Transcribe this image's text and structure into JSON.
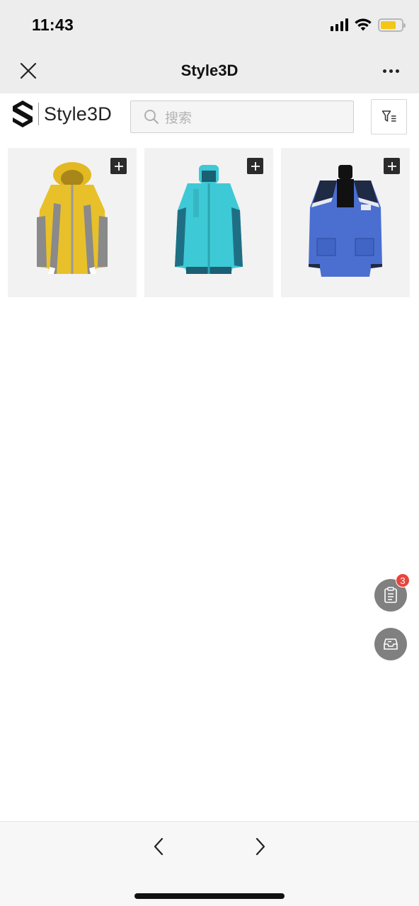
{
  "status_bar": {
    "time": "11:43",
    "icons": [
      "signal-icon",
      "wifi-icon",
      "battery-icon"
    ],
    "battery_color": "#f5c518"
  },
  "nav_bar": {
    "title": "Style3D",
    "left_icon": "close-icon",
    "right_icon": "more-icon"
  },
  "header": {
    "brand_name": "Style3D",
    "search": {
      "placeholder": "搜索",
      "value": ""
    },
    "filter_icon": "filter-icon"
  },
  "products": [
    {
      "name": "yellow-ski-jacket",
      "main_color": "#e8c02a",
      "accent_color": "#8a8a8a"
    },
    {
      "name": "turquoise-jacket",
      "main_color": "#3ec9d6",
      "accent_color": "#1b5f73"
    },
    {
      "name": "blue-parka",
      "main_color": "#4a6fd0",
      "accent_color": "#1f2a44"
    }
  ],
  "floating_buttons": {
    "cart": {
      "icon": "clipboard-icon",
      "badge": "3"
    },
    "inbox": {
      "icon": "inbox-icon"
    }
  },
  "bottom_bar": {
    "back_icon": "chevron-left-icon",
    "forward_icon": "chevron-right-icon"
  }
}
